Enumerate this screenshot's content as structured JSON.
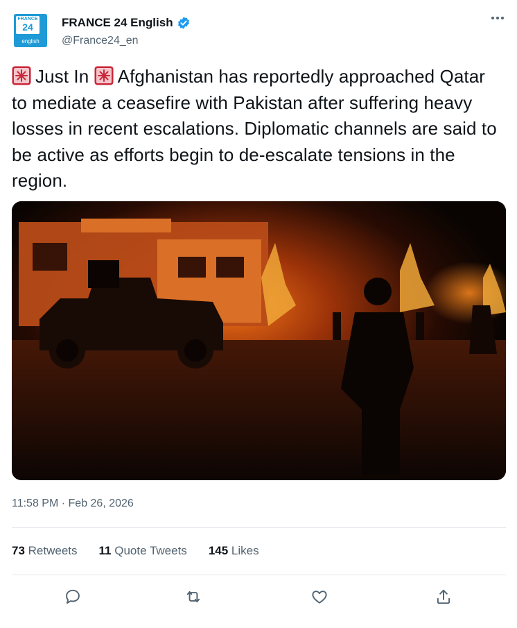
{
  "account": {
    "avatar_top": "FRANCE",
    "avatar_num": "24",
    "avatar_sub": "english",
    "display_name": "FRANCE 24 English",
    "handle": "@France24_en"
  },
  "tweet": {
    "tag": "Just In",
    "text": "Afghanistan has reportedly approached Qatar to mediate a ceasefire with Pakistan after suffering heavy losses in recent escalations. Diplomatic channels are said to be active as efforts begin to de-escalate tensions in the region."
  },
  "timestamp": "11:58 PM · Feb 26, 2026",
  "stats": {
    "retweets_count": "73",
    "retweets_label": " Retweets",
    "quotes_count": "11",
    "quotes_label": " Quote Tweets",
    "likes_count": "145",
    "likes_label": " Likes"
  },
  "icons": {
    "siren": "rotating-light-icon",
    "verified": "verified-badge-icon",
    "more": "more-icon",
    "reply": "reply-icon",
    "retweet": "retweet-icon",
    "like": "heart-icon",
    "share": "share-icon"
  },
  "colors": {
    "text": "#0f1419",
    "secondary": "#536471",
    "verified": "#1d9bf0",
    "brand": "#1f9ad6"
  }
}
